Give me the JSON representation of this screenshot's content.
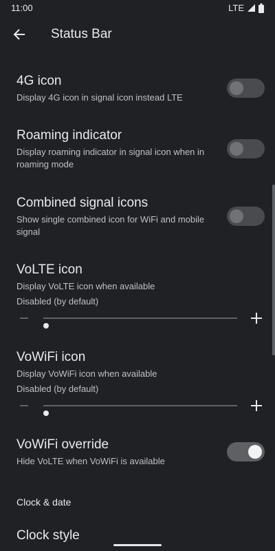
{
  "status_bar": {
    "time": "11:00",
    "network": "LTE"
  },
  "app_bar": {
    "title": "Status Bar"
  },
  "preferences": [
    {
      "title": "4G icon",
      "summary": "Display 4G icon in signal icon instead LTE",
      "enabled": false
    },
    {
      "title": "Roaming indicator",
      "summary": "Display roaming indicator in signal icon when in roaming mode",
      "enabled": false
    },
    {
      "title": "Combined signal icons",
      "summary": "Show single combined icon for WiFi and mobile signal",
      "enabled": false
    }
  ],
  "sliders": [
    {
      "title": "VoLTE icon",
      "summary": "Display VoLTE icon when available",
      "state": "Disabled (by default)",
      "value": 0
    },
    {
      "title": "VoWiFi icon",
      "summary": "Display VoWiFi icon when available",
      "state": "Disabled (by default)",
      "value": 0
    }
  ],
  "override": {
    "title": "VoWiFi override",
    "summary": "Hide VoLTE when VoWiFi is available",
    "enabled": true
  },
  "category": {
    "title": "Clock & date"
  },
  "clock": {
    "title": "Clock style"
  },
  "colors": {
    "background": "#202124",
    "text": "#e8eaed",
    "secondary_text": "#bdc1c6"
  },
  "icons": [
    "back-arrow-icon",
    "signal-icon",
    "battery-icon",
    "minus-icon",
    "plus-icon"
  ]
}
